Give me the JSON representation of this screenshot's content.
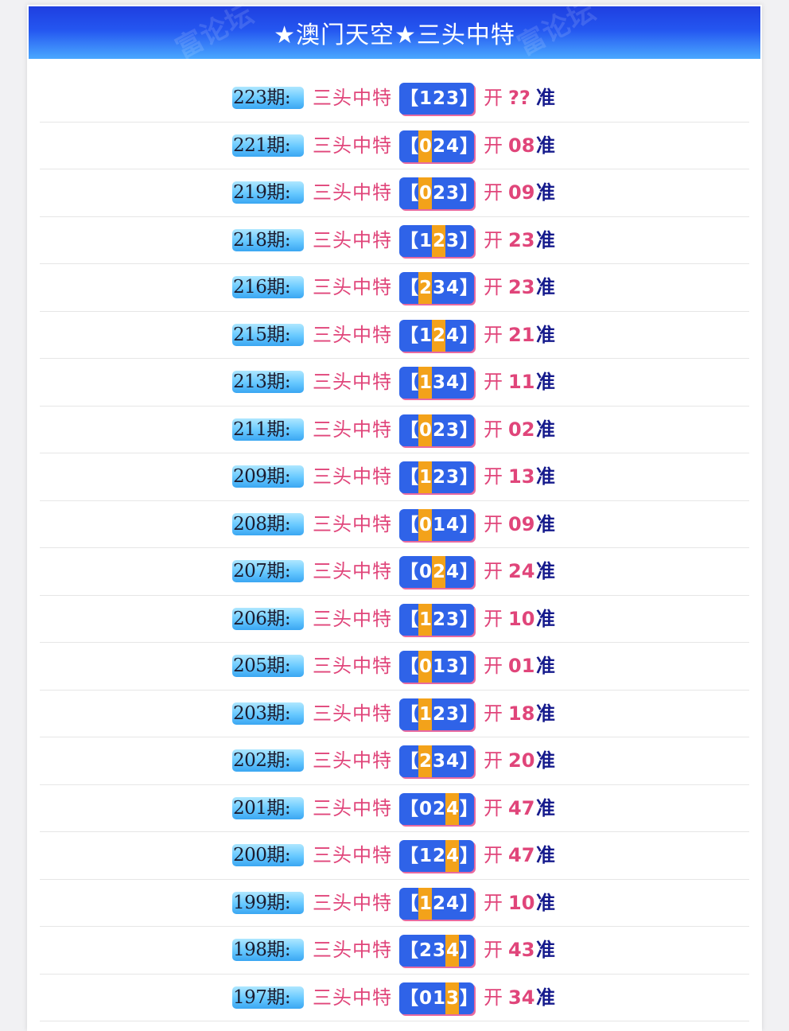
{
  "header": {
    "title": "★澳门天空★三头中特",
    "watermark": "富论坛"
  },
  "colors": {
    "header_blue": "#2456f0",
    "pink": "#e0457a",
    "navy": "#151a8c",
    "highlight": "#f3a21a",
    "box_blue": "#2f63e8"
  },
  "rows": [
    {
      "issue": "223期:",
      "label": "三头中特",
      "digits": [
        "【",
        "1",
        "2",
        "3",
        "】"
      ],
      "hl": -1,
      "kai": "开",
      "result": "??",
      "zhun": "准"
    },
    {
      "issue": "221期:",
      "label": "三头中特",
      "digits": [
        "【",
        "0",
        "2",
        "4",
        "】"
      ],
      "hl": 1,
      "kai": "开",
      "result": "08",
      "zhun": "准"
    },
    {
      "issue": "219期:",
      "label": "三头中特",
      "digits": [
        "【",
        "0",
        "2",
        "3",
        "】"
      ],
      "hl": 1,
      "kai": "开",
      "result": "09",
      "zhun": "准"
    },
    {
      "issue": "218期:",
      "label": "三头中特",
      "digits": [
        "【",
        "1",
        "2",
        "3",
        "】"
      ],
      "hl": 2,
      "kai": "开",
      "result": "23",
      "zhun": "准"
    },
    {
      "issue": "216期:",
      "label": "三头中特",
      "digits": [
        "【",
        "2",
        "3",
        "4",
        "】"
      ],
      "hl": 1,
      "kai": "开",
      "result": "23",
      "zhun": "准"
    },
    {
      "issue": "215期:",
      "label": "三头中特",
      "digits": [
        "【",
        "1",
        "2",
        "4",
        "】"
      ],
      "hl": 2,
      "kai": "开",
      "result": "21",
      "zhun": "准"
    },
    {
      "issue": "213期:",
      "label": "三头中特",
      "digits": [
        "【",
        "1",
        "3",
        "4",
        "】"
      ],
      "hl": 1,
      "kai": "开",
      "result": "11",
      "zhun": "准"
    },
    {
      "issue": "211期:",
      "label": "三头中特",
      "digits": [
        "【",
        "0",
        "2",
        "3",
        "】"
      ],
      "hl": 1,
      "kai": "开",
      "result": "02",
      "zhun": "准"
    },
    {
      "issue": "209期:",
      "label": "三头中特",
      "digits": [
        "【",
        "1",
        "2",
        "3",
        "】"
      ],
      "hl": 1,
      "kai": "开",
      "result": "13",
      "zhun": "准"
    },
    {
      "issue": "208期:",
      "label": "三头中特",
      "digits": [
        "【",
        "0",
        "1",
        "4",
        "】"
      ],
      "hl": 1,
      "kai": "开",
      "result": "09",
      "zhun": "准"
    },
    {
      "issue": "207期:",
      "label": "三头中特",
      "digits": [
        "【",
        "0",
        "2",
        "4",
        "】"
      ],
      "hl": 2,
      "kai": "开",
      "result": "24",
      "zhun": "准"
    },
    {
      "issue": "206期:",
      "label": "三头中特",
      "digits": [
        "【",
        "1",
        "2",
        "3",
        "】"
      ],
      "hl": 1,
      "kai": "开",
      "result": "10",
      "zhun": "准"
    },
    {
      "issue": "205期:",
      "label": "三头中特",
      "digits": [
        "【",
        "0",
        "1",
        "3",
        "】"
      ],
      "hl": 1,
      "kai": "开",
      "result": "01",
      "zhun": "准"
    },
    {
      "issue": "203期:",
      "label": "三头中特",
      "digits": [
        "【",
        "1",
        "2",
        "3",
        "】"
      ],
      "hl": 1,
      "kai": "开",
      "result": "18",
      "zhun": "准"
    },
    {
      "issue": "202期:",
      "label": "三头中特",
      "digits": [
        "【",
        "2",
        "3",
        "4",
        "】"
      ],
      "hl": 1,
      "kai": "开",
      "result": "20",
      "zhun": "准"
    },
    {
      "issue": "201期:",
      "label": "三头中特",
      "digits": [
        "【",
        "0",
        "2",
        "4",
        "】"
      ],
      "hl": 3,
      "kai": "开",
      "result": "47",
      "zhun": "准"
    },
    {
      "issue": "200期:",
      "label": "三头中特",
      "digits": [
        "【",
        "1",
        "2",
        "4",
        "】"
      ],
      "hl": 3,
      "kai": "开",
      "result": "47",
      "zhun": "准"
    },
    {
      "issue": "199期:",
      "label": "三头中特",
      "digits": [
        "【",
        "1",
        "2",
        "4",
        "】"
      ],
      "hl": 1,
      "kai": "开",
      "result": "10",
      "zhun": "准"
    },
    {
      "issue": "198期:",
      "label": "三头中特",
      "digits": [
        "【",
        "2",
        "3",
        "4",
        "】"
      ],
      "hl": 3,
      "kai": "开",
      "result": "43",
      "zhun": "准"
    },
    {
      "issue": "197期:",
      "label": "三头中特",
      "digits": [
        "【",
        "0",
        "1",
        "3",
        "】"
      ],
      "hl": 3,
      "kai": "开",
      "result": "34",
      "zhun": "准"
    }
  ]
}
